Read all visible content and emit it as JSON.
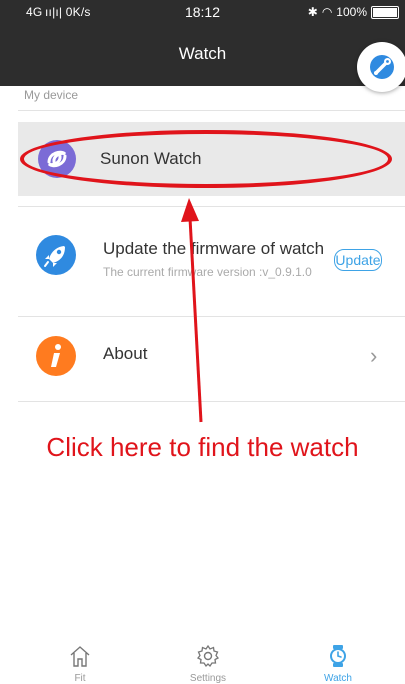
{
  "status_bar": {
    "left": "4G ıı|ı| 0K/s",
    "time": "18:12",
    "battery": "100%"
  },
  "header": {
    "title": "Watch"
  },
  "section": {
    "my_device": "My device"
  },
  "device": {
    "name": "Sunon Watch",
    "icon_color": "#7b6bd6"
  },
  "firmware": {
    "title": "Update the firmware of watch",
    "subtitle": "The current firmware version :v_0.9.1.0",
    "button": "Update",
    "icon_color": "#2f8ae0"
  },
  "about": {
    "label": "About",
    "icon_color": "#ff7b1f"
  },
  "annotation": {
    "text": "Click here to find the watch",
    "color": "#e0141b"
  },
  "tabs": [
    {
      "label": "Fit",
      "active": false
    },
    {
      "label": "Settings",
      "active": false
    },
    {
      "label": "Watch",
      "active": true
    }
  ],
  "colors": {
    "accent": "#3ea3e6",
    "header_bg": "#2d2d2d"
  }
}
